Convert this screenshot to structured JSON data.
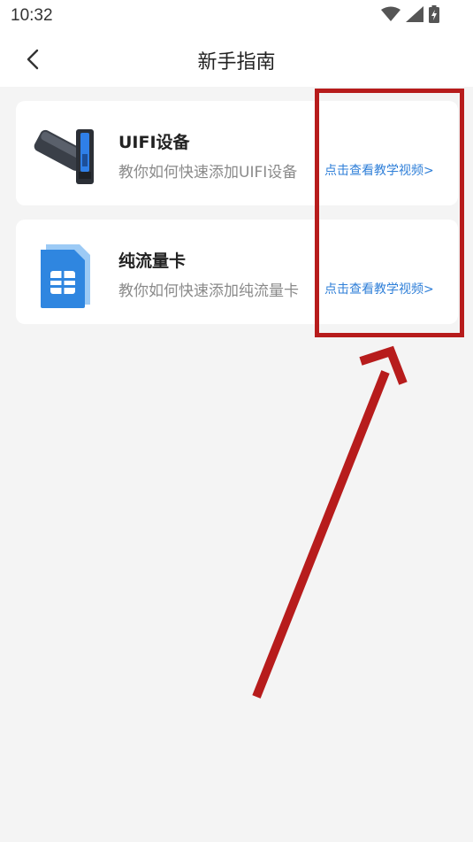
{
  "status_bar": {
    "time": "10:32"
  },
  "header": {
    "title": "新手指南"
  },
  "guides": [
    {
      "name": "UIFI设备",
      "desc": "教你如何快速添加UIFI设备",
      "link": "点击查看教学视频>"
    },
    {
      "name": "纯流量卡",
      "desc": "教你如何快速添加纯流量卡",
      "link": "点击查看教学视频>"
    }
  ],
  "colors": {
    "accent_link": "#2f7fd8",
    "annotation": "#b71c1c",
    "background": "#f4f4f4"
  },
  "icons": [
    "wifi-icon",
    "signal-icon",
    "battery-icon",
    "back-arrow-icon",
    "uifi-device-icon",
    "sim-card-icon"
  ]
}
